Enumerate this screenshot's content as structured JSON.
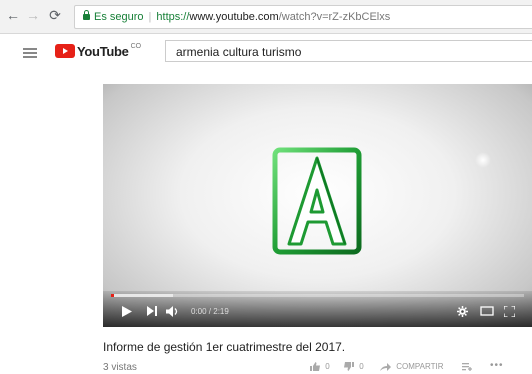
{
  "browser": {
    "secure_label": "Es seguro",
    "url_scheme": "https://",
    "url_host": "www.youtube.com",
    "url_path": "/watch?v=rZ-zKbCElxs"
  },
  "youtube": {
    "logo_text": "YouTube",
    "country_code": "CO",
    "search_value": "armenia cultura turismo"
  },
  "player": {
    "current_time": "0:00",
    "duration": "2:19",
    "time_display": "0:00 / 2:19",
    "progress_fraction": 0.0,
    "buffered_fraction": 0.15
  },
  "video": {
    "title": "Informe de gestión 1er cuatrimestre del 2017.",
    "views": "3 vistas",
    "likes": "0",
    "dislikes": "0",
    "share_label": "COMPARTIR"
  },
  "colors": {
    "accent_red": "#e62117",
    "secure_green": "#188038",
    "logo_green": "#2db34a"
  }
}
